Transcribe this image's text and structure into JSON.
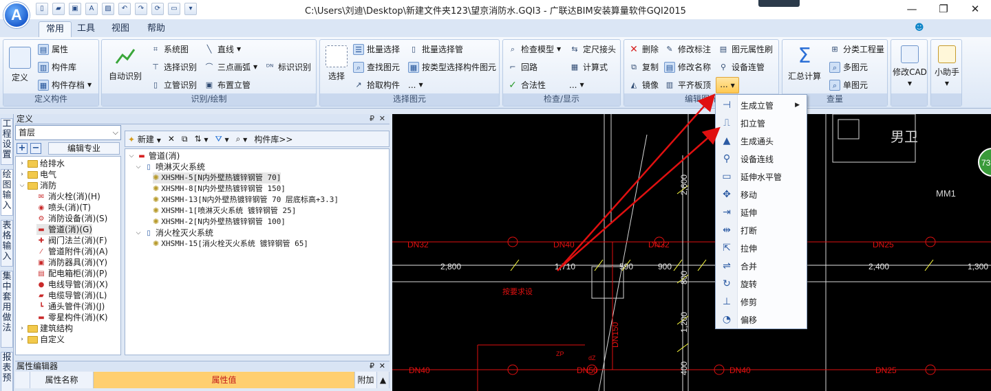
{
  "window": {
    "title": "C:\\Users\\刘迪\\Desktop\\新建文件夹123\\望京消防水.GQI3 - 广联达BIM安装算量软件GQI2015",
    "logo_letter": "A",
    "minimize": "—",
    "restore": "❐",
    "close": "✕"
  },
  "tabs": [
    "常用",
    "工具",
    "视图",
    "帮助"
  ],
  "ribbon": {
    "groups": {
      "define": {
        "label": "定义构件",
        "big_button": "定义",
        "items": [
          "属性",
          "构件库",
          "构件存档"
        ]
      },
      "identify": {
        "label": "识别/绘制",
        "big_button": "自动识别",
        "items": [
          "系统图",
          "选择识别",
          "立管识别",
          "直线",
          "三点画弧",
          "布置立管",
          "标识识别"
        ]
      },
      "select": {
        "label": "选择图元",
        "big_button": "选择",
        "items": [
          "批量选择",
          "查找图元",
          "拾取构件",
          "批量选择管",
          "按类型选择构件图元",
          "..."
        ]
      },
      "check": {
        "label": "检查/显示",
        "items": [
          "检查模型",
          "回路",
          "合法性",
          "定尺接头",
          "计算式",
          "..."
        ]
      },
      "edit": {
        "label": "编辑图元",
        "items": [
          "删除",
          "复制",
          "镜像",
          "修改标注",
          "修改名称",
          "平齐板顶",
          "图元属性刷",
          "设备连管",
          "..."
        ]
      },
      "quantity": {
        "label": "查量",
        "big_button": "汇总计算",
        "items": [
          "分类工程量",
          "多图元",
          "单图元"
        ]
      },
      "cad": {
        "big_button": "修改CAD"
      },
      "helper": {
        "big_button": "小助手"
      }
    }
  },
  "left_strip": [
    "工程设置",
    "绘图输入",
    "表格输入",
    "集中套用做法",
    "报表预"
  ],
  "define_panel": {
    "title": "定义",
    "floor": "首层",
    "edit_specialty": "编辑专业",
    "tree": [
      {
        "label": "给排水",
        "type": "folder",
        "expanded": false
      },
      {
        "label": "电气",
        "type": "folder",
        "expanded": false
      },
      {
        "label": "消防",
        "type": "folder",
        "expanded": true
      },
      {
        "label": "消火栓(消)(H)",
        "type": "item"
      },
      {
        "label": "喷头(消)(T)",
        "type": "item"
      },
      {
        "label": "消防设备(消)(S)",
        "type": "item"
      },
      {
        "label": "管道(消)(G)",
        "type": "item",
        "selected": true
      },
      {
        "label": "阀门法兰(消)(F)",
        "type": "item"
      },
      {
        "label": "管道附件(消)(A)",
        "type": "item"
      },
      {
        "label": "消防器具(消)(Y)",
        "type": "item"
      },
      {
        "label": "配电箱柜(消)(P)",
        "type": "item"
      },
      {
        "label": "电线导管(消)(X)",
        "type": "item"
      },
      {
        "label": "电缆导管(消)(L)",
        "type": "item"
      },
      {
        "label": "通头管件(消)(J)",
        "type": "item"
      },
      {
        "label": "零星构件(消)(K)",
        "type": "item"
      },
      {
        "label": "建筑结构",
        "type": "folder",
        "expanded": false
      },
      {
        "label": "自定义",
        "type": "folder",
        "expanded": false
      }
    ]
  },
  "component_panel": {
    "toolbar": {
      "new": "新建",
      "library": "构件库>>"
    },
    "tree": [
      {
        "label": "管道(消)",
        "level": 0
      },
      {
        "label": "喷淋灭火系统",
        "level": 1
      },
      {
        "label": "XHSMH-5[N内外壁热镀锌钢管 70]",
        "level": 2,
        "selected": true
      },
      {
        "label": "XHSMH-8[N内外壁热镀锌钢管 150]",
        "level": 2
      },
      {
        "label": "XHSMH-13[N内外壁热镀锌钢管 70 层底标高+3.3]",
        "level": 2
      },
      {
        "label": "XHSMH-1[喷淋灭火系统 镀锌钢管 25]",
        "level": 2
      },
      {
        "label": "XHSMH-2[N内外壁热镀锌钢管 100]",
        "level": 2
      },
      {
        "label": "消火栓灭火系统",
        "level": 1
      },
      {
        "label": "XHSMH-15[消火栓灭火系统 镀锌钢管 65]",
        "level": 2
      }
    ]
  },
  "property_editor": {
    "title": "属性编辑器",
    "columns": [
      "属性名称",
      "属性值",
      "附加"
    ]
  },
  "popup_menu": {
    "items": [
      {
        "label": "生成立管",
        "icon": "riser-icon",
        "submenu": true
      },
      {
        "label": "扣立管",
        "icon": "deduct-riser-icon"
      },
      {
        "label": "生成通头",
        "icon": "fitting-icon"
      },
      {
        "label": "设备连线",
        "icon": "device-wire-icon"
      },
      {
        "label": "延伸水平管",
        "icon": "extend-pipe-icon"
      },
      {
        "label": "移动",
        "icon": "move-icon"
      },
      {
        "label": "延伸",
        "icon": "extend-icon"
      },
      {
        "label": "打断",
        "icon": "break-icon"
      },
      {
        "label": "拉伸",
        "icon": "stretch-icon"
      },
      {
        "label": "合并",
        "icon": "merge-icon"
      },
      {
        "label": "旋转",
        "icon": "rotate-icon"
      },
      {
        "label": "修剪",
        "icon": "trim-icon"
      },
      {
        "label": "偏移",
        "icon": "offset-icon"
      }
    ]
  },
  "canvas": {
    "room_label": "男卫",
    "door_label": "MM1",
    "badge": "73",
    "pipe_labels": [
      "DN32",
      "DN40",
      "DN32",
      "DN25",
      "DN40",
      "DN50",
      "DN40",
      "DN25",
      "DN150"
    ],
    "dims_horizontal": [
      "2,800",
      "1,710",
      "590",
      "900",
      "2,400",
      "1,300"
    ],
    "dims_vertical": [
      "2,600",
      "800",
      "1,200",
      "400"
    ],
    "annotation": "按要求设",
    "small_labels": [
      "ZP",
      "dZ"
    ],
    "colors": {
      "pipe": "#e01010",
      "dim": "#e6e6e6",
      "dim_tick": "#ffff40",
      "wall": "#d8d8d8"
    }
  },
  "colors": {
    "accent": "#1e5fcf",
    "ribbon_label": "#c9d8ee",
    "arrow": "#e01010",
    "highlight": "#ffc84f"
  }
}
